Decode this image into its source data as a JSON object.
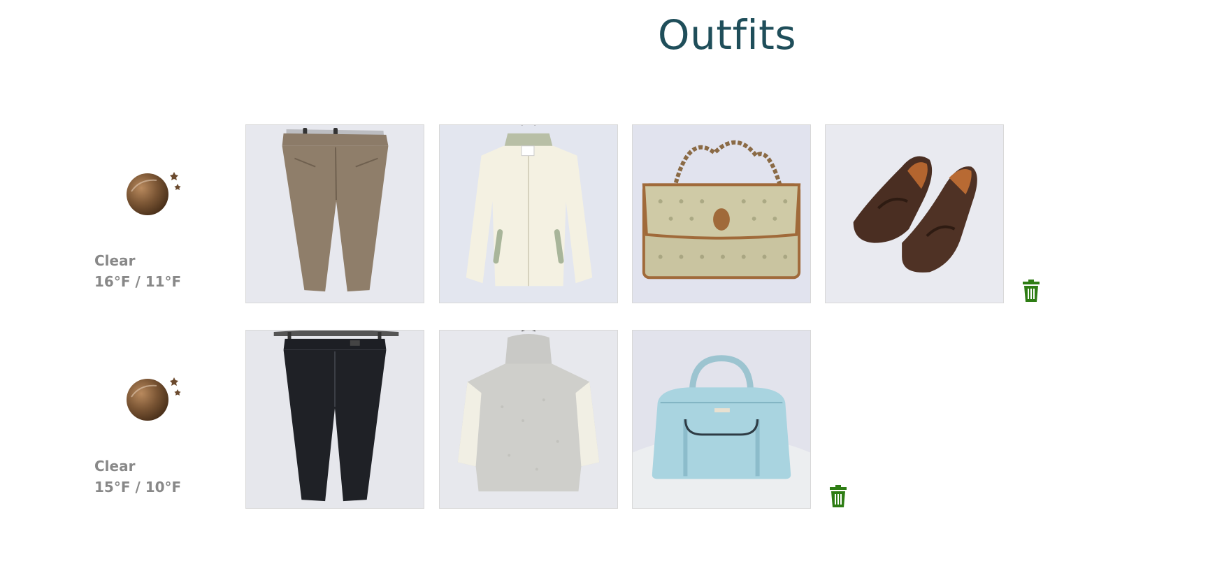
{
  "page": {
    "title": "Outfits"
  },
  "colors": {
    "title": "#1f4e5a",
    "weather_text": "#888888",
    "trash": "#2e7d14",
    "weather_icon": "#6b4a2e"
  },
  "outfits": [
    {
      "weather": {
        "icon": "clear-night-icon",
        "condition": "Clear",
        "temps": "16°F / 11°F"
      },
      "items": [
        {
          "kind": "trousers",
          "icon": "taupe-trousers"
        },
        {
          "kind": "jacket",
          "icon": "cream-jacket"
        },
        {
          "kind": "handbag",
          "icon": "monogram-flap-bag"
        },
        {
          "kind": "shoes",
          "icon": "brown-loafers"
        }
      ],
      "delete_icon": "trash-icon"
    },
    {
      "weather": {
        "icon": "clear-night-icon",
        "condition": "Clear",
        "temps": "15°F / 10°F"
      },
      "items": [
        {
          "kind": "trousers",
          "icon": "black-trousers"
        },
        {
          "kind": "sweater",
          "icon": "grey-turtleneck-poncho"
        },
        {
          "kind": "handbag",
          "icon": "light-blue-satchel"
        }
      ],
      "delete_icon": "trash-icon"
    }
  ]
}
